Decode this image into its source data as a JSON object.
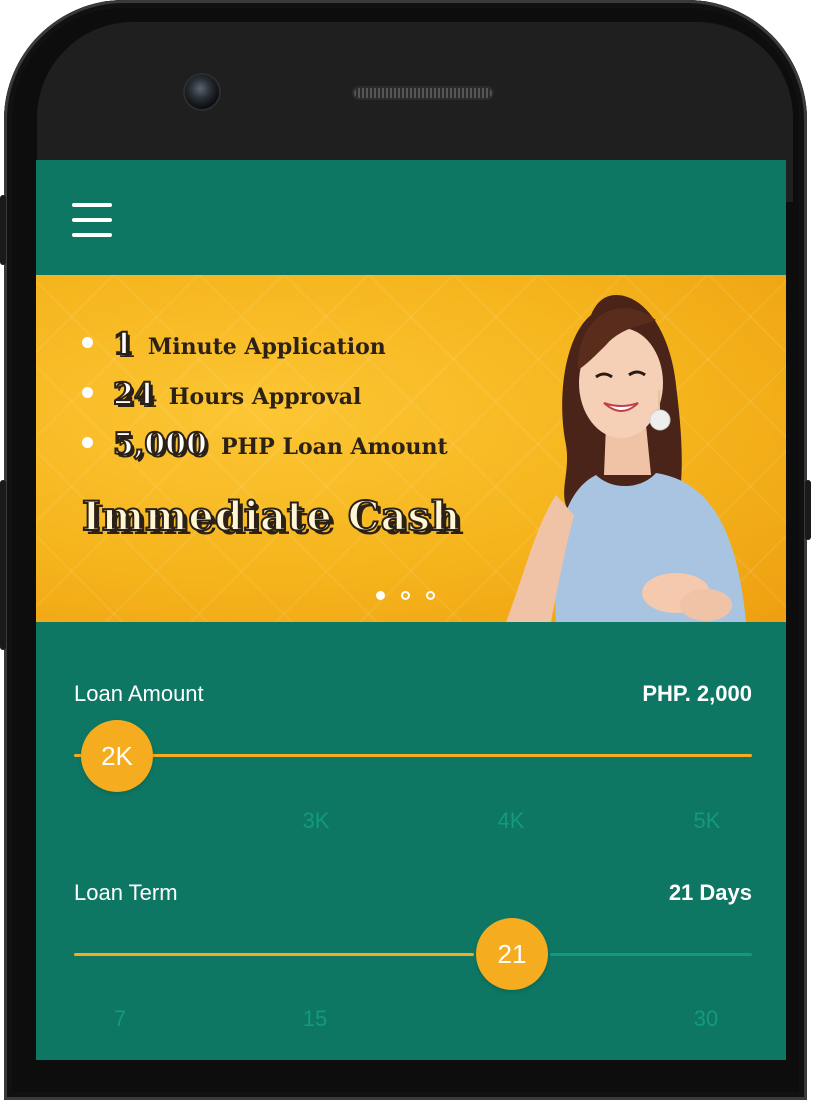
{
  "app": {
    "header": {
      "menu_icon": "hamburger-icon"
    },
    "banner": {
      "bullets": [
        {
          "number": "1",
          "text": "Minute Application"
        },
        {
          "number": "24",
          "text": "Hours Approval"
        },
        {
          "number": "5,000",
          "text": "PHP Loan Amount"
        }
      ],
      "headline": "Immediate Cash",
      "carousel": {
        "pages": 3,
        "active": 1
      }
    },
    "loan_amount": {
      "label": "Loan Amount",
      "value": "PHP. 2,000",
      "thumb_label": "2K",
      "ticks": [
        "3K",
        "4K",
        "5K"
      ],
      "slider_fraction": 0.0
    },
    "loan_term": {
      "label": "Loan Term",
      "value": "21 Days",
      "thumb_label": "21",
      "ticks": [
        "7",
        "15",
        "30"
      ],
      "slider_fraction": 0.65
    },
    "colors": {
      "primary": "#0e7763",
      "accent": "#f6ac1f",
      "track_inactive": "#13997e",
      "banner": "#f5b41c"
    }
  }
}
